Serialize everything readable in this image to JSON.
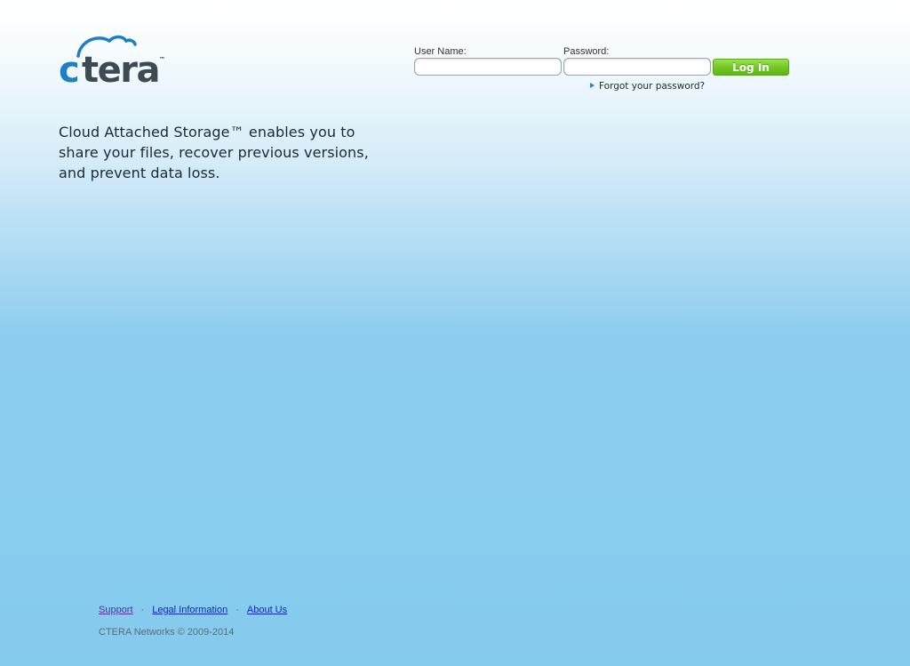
{
  "logo": {
    "text": "ctera",
    "trademark": "™",
    "colors": {
      "c": "#1f7fc4",
      "tera": "#3d4a53",
      "cloud": "#1f7fc4"
    }
  },
  "tagline": "Cloud Attached Storage™ enables you to share your files, recover previous versions, and prevent data loss.",
  "login": {
    "username_label": "User Name:",
    "username_value": "",
    "password_label": "Password:",
    "password_value": "",
    "button_label": "Log In",
    "forgot_label": "Forgot your password?",
    "button_color": "#74c826",
    "arrow_color": "#1f86d1"
  },
  "footer": {
    "links": {
      "support": "Support",
      "legal": "Legal Information",
      "about": "About Us"
    },
    "separator": "·",
    "copyright": "CTERA Networks © 2009-2014"
  }
}
